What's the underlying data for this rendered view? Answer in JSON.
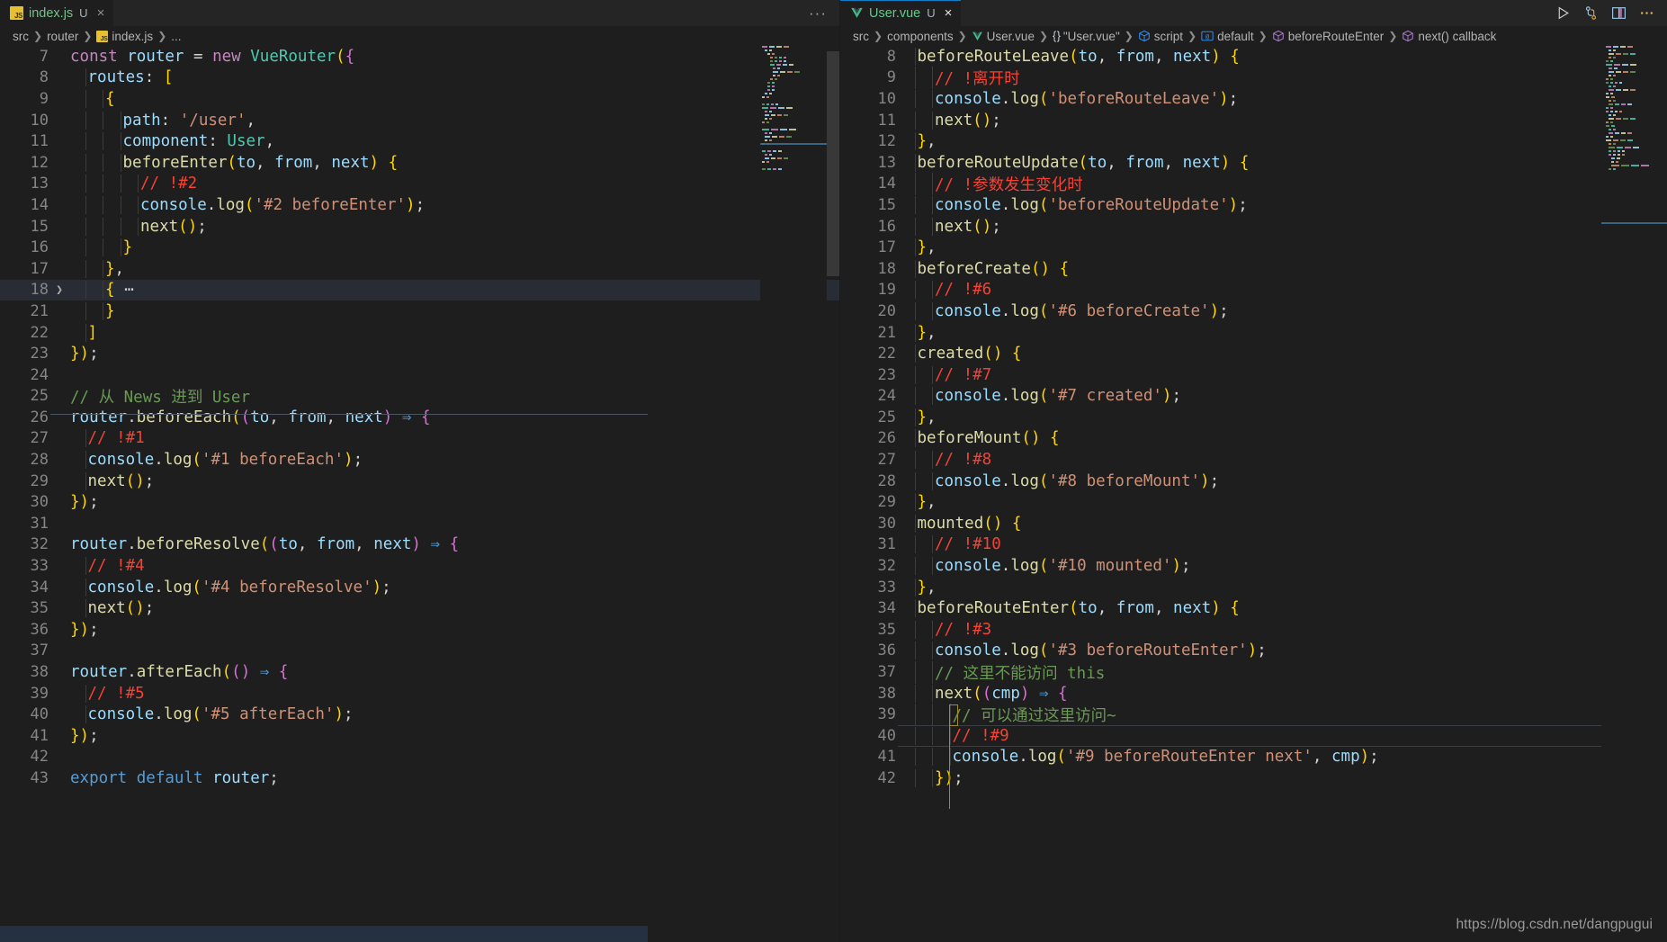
{
  "window": {
    "theme_bg": "#1e1e1e",
    "tabbar_bg": "#252526",
    "accent": "#0f7ec8",
    "watermark": "https://blog.csdn.net/dangpugui"
  },
  "left_pane": {
    "tab": {
      "icon": "js-file-icon",
      "name": "index.js",
      "dirty_badge": "U",
      "close_label": "×",
      "more_actions_label": "···"
    },
    "breadcrumb": [
      {
        "label": "src",
        "icon": ""
      },
      {
        "label": "router",
        "icon": ""
      },
      {
        "label": "index.js",
        "icon": "js-file-icon"
      },
      {
        "label": "...",
        "icon": ""
      }
    ],
    "first_line_number": 7,
    "lines": [
      {
        "n": "7",
        "indent": 0,
        "text": "const router = new VueRouter({"
      },
      {
        "n": "8",
        "indent": 1,
        "text": "routes: ["
      },
      {
        "n": "9",
        "indent": 2,
        "text": "{"
      },
      {
        "n": "10",
        "indent": 3,
        "text": "path: '/user',"
      },
      {
        "n": "11",
        "indent": 3,
        "text": "component: User,"
      },
      {
        "n": "12",
        "indent": 3,
        "text": "beforeEnter(to, from, next) {"
      },
      {
        "n": "13",
        "indent": 4,
        "text": "// !#2"
      },
      {
        "n": "14",
        "indent": 4,
        "text": "console.log('#2 beforeEnter');"
      },
      {
        "n": "15",
        "indent": 4,
        "text": "next();"
      },
      {
        "n": "16",
        "indent": 3,
        "text": "}"
      },
      {
        "n": "17",
        "indent": 2,
        "text": "},"
      },
      {
        "n": "18",
        "indent": 2,
        "text": "{ ⋯",
        "folded": true,
        "current": true
      },
      {
        "n": "21",
        "indent": 2,
        "text": "}"
      },
      {
        "n": "22",
        "indent": 1,
        "text": "]"
      },
      {
        "n": "23",
        "indent": 0,
        "text": "});"
      },
      {
        "n": "24",
        "indent": 0,
        "text": ""
      },
      {
        "n": "25",
        "indent": 0,
        "text": "// 从 News 进到 User"
      },
      {
        "n": "26",
        "indent": 0,
        "text": "router.beforeEach((to, from, next) ⇒ {"
      },
      {
        "n": "27",
        "indent": 1,
        "text": "// !#1"
      },
      {
        "n": "28",
        "indent": 1,
        "text": "console.log('#1 beforeEach');"
      },
      {
        "n": "29",
        "indent": 1,
        "text": "next();"
      },
      {
        "n": "30",
        "indent": 0,
        "text": "});"
      },
      {
        "n": "31",
        "indent": 0,
        "text": ""
      },
      {
        "n": "32",
        "indent": 0,
        "text": "router.beforeResolve((to, from, next) ⇒ {"
      },
      {
        "n": "33",
        "indent": 1,
        "text": "// !#4"
      },
      {
        "n": "34",
        "indent": 1,
        "text": "console.log('#4 beforeResolve');"
      },
      {
        "n": "35",
        "indent": 1,
        "text": "next();"
      },
      {
        "n": "36",
        "indent": 0,
        "text": "});"
      },
      {
        "n": "37",
        "indent": 0,
        "text": ""
      },
      {
        "n": "38",
        "indent": 0,
        "text": "router.afterEach(() ⇒ {"
      },
      {
        "n": "39",
        "indent": 1,
        "text": "// !#5"
      },
      {
        "n": "40",
        "indent": 1,
        "text": "console.log('#5 afterEach');"
      },
      {
        "n": "41",
        "indent": 0,
        "text": "});"
      },
      {
        "n": "42",
        "indent": 0,
        "text": ""
      },
      {
        "n": "43",
        "indent": 0,
        "text": "export default router;"
      }
    ]
  },
  "right_pane": {
    "tab": {
      "icon": "vue-file-icon",
      "name": "User.vue",
      "dirty_badge": "U",
      "close_label": "×"
    },
    "toolbar": [
      {
        "name": "run-button",
        "glyph": "play"
      },
      {
        "name": "source-control-icon",
        "glyph": "git"
      },
      {
        "name": "split-editor-button",
        "glyph": "split"
      },
      {
        "name": "more-actions-button",
        "glyph": "dots"
      }
    ],
    "breadcrumb": [
      {
        "label": "src",
        "icon": ""
      },
      {
        "label": "components",
        "icon": ""
      },
      {
        "label": "User.vue",
        "icon": "vue-file-icon"
      },
      {
        "label": "\"User.vue\"",
        "icon": "braces-icon"
      },
      {
        "label": "script",
        "icon": "cube-blue-icon"
      },
      {
        "label": "default",
        "icon": "at-icon"
      },
      {
        "label": "beforeRouteEnter",
        "icon": "cube-purple-icon"
      },
      {
        "label": "next() callback",
        "icon": "cube-purple-icon"
      }
    ],
    "first_line_number": 8,
    "lines": [
      {
        "n": "8",
        "indent": 1,
        "text": "beforeRouteLeave(to, from, next) {"
      },
      {
        "n": "9",
        "indent": 2,
        "text": "// !离开时"
      },
      {
        "n": "10",
        "indent": 2,
        "text": "console.log('beforeRouteLeave');"
      },
      {
        "n": "11",
        "indent": 2,
        "text": "next();"
      },
      {
        "n": "12",
        "indent": 1,
        "text": "},"
      },
      {
        "n": "13",
        "indent": 1,
        "text": "beforeRouteUpdate(to, from, next) {"
      },
      {
        "n": "14",
        "indent": 2,
        "text": "// !参数发生变化时"
      },
      {
        "n": "15",
        "indent": 2,
        "text": "console.log('beforeRouteUpdate');"
      },
      {
        "n": "16",
        "indent": 2,
        "text": "next();"
      },
      {
        "n": "17",
        "indent": 1,
        "text": "},"
      },
      {
        "n": "18",
        "indent": 1,
        "text": "beforeCreate() {"
      },
      {
        "n": "19",
        "indent": 2,
        "text": "// !#6"
      },
      {
        "n": "20",
        "indent": 2,
        "text": "console.log('#6 beforeCreate');"
      },
      {
        "n": "21",
        "indent": 1,
        "text": "},"
      },
      {
        "n": "22",
        "indent": 1,
        "text": "created() {"
      },
      {
        "n": "23",
        "indent": 2,
        "text": "// !#7"
      },
      {
        "n": "24",
        "indent": 2,
        "text": "console.log('#7 created');"
      },
      {
        "n": "25",
        "indent": 1,
        "text": "},"
      },
      {
        "n": "26",
        "indent": 1,
        "text": "beforeMount() {"
      },
      {
        "n": "27",
        "indent": 2,
        "text": "// !#8"
      },
      {
        "n": "28",
        "indent": 2,
        "text": "console.log('#8 beforeMount');"
      },
      {
        "n": "29",
        "indent": 1,
        "text": "},"
      },
      {
        "n": "30",
        "indent": 1,
        "text": "mounted() {"
      },
      {
        "n": "31",
        "indent": 2,
        "text": "// !#10"
      },
      {
        "n": "32",
        "indent": 2,
        "text": "console.log('#10 mounted');"
      },
      {
        "n": "33",
        "indent": 1,
        "text": "},"
      },
      {
        "n": "34",
        "indent": 1,
        "text": "beforeRouteEnter(to, from, next) {"
      },
      {
        "n": "35",
        "indent": 2,
        "text": "// !#3"
      },
      {
        "n": "36",
        "indent": 2,
        "text": "console.log('#3 beforeRouteEnter');"
      },
      {
        "n": "37",
        "indent": 2,
        "text": "// 这里不能访问 this"
      },
      {
        "n": "38",
        "indent": 2,
        "text": "next((cmp) ⇒ {"
      },
      {
        "n": "39",
        "indent": 3,
        "text": "// 可以通过这里访问~"
      },
      {
        "n": "40",
        "indent": 3,
        "text": "// !#9",
        "current": true
      },
      {
        "n": "41",
        "indent": 3,
        "text": "console.log('#9 beforeRouteEnter next', cmp);"
      },
      {
        "n": "42",
        "indent": 2,
        "text": "});"
      }
    ]
  },
  "colors": {
    "keyword": "#c586c0",
    "keyword_blue": "#569cd6",
    "identifier": "#9cdcfe",
    "class": "#4ec9b0",
    "function": "#dcdcaa",
    "string": "#ce9178",
    "comment": "#6a9955",
    "comment_alert": "#f44336",
    "bracket_1": "#ffd700",
    "bracket_2": "#da70d6",
    "bracket_3": "#179fff",
    "plain": "#d4d4d4",
    "current_line_bg": "#282d35"
  }
}
